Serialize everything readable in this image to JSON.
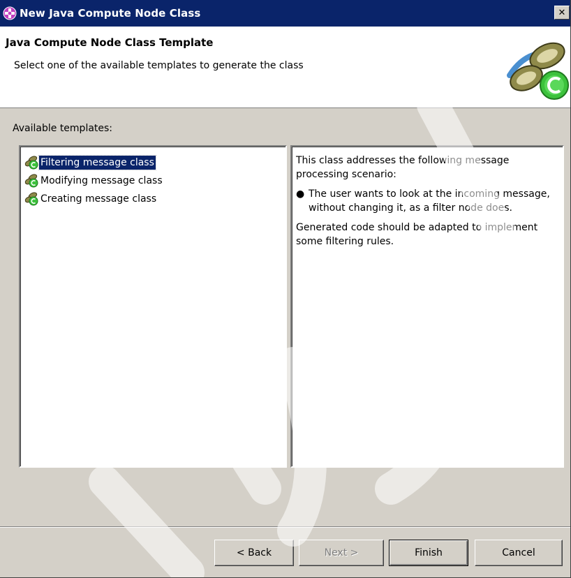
{
  "window": {
    "title": "New Java Compute Node Class",
    "close_glyph": "✕"
  },
  "banner": {
    "title": "Java Compute Node Class Template",
    "subtitle": "Select one of the available templates to generate the class"
  },
  "templates": {
    "label": "Available templates:",
    "items": [
      {
        "label": "Filtering message class",
        "icon": "java-compute-class-icon",
        "selected": true
      },
      {
        "label": "Modifying message class",
        "icon": "java-compute-class-icon",
        "selected": false
      },
      {
        "label": "Creating message class",
        "icon": "java-compute-class-icon",
        "selected": false
      }
    ]
  },
  "description": {
    "intro": "This class addresses the following message processing scenario:",
    "bullet": "The user wants to look at the incoming message, without changing it, as a filter node does.",
    "outro": "Generated code should be adapted to implement some filtering rules."
  },
  "buttons": {
    "back": "< Back",
    "next": "Next >",
    "finish": "Finish",
    "cancel": "Cancel"
  },
  "colors": {
    "titlebar": "#0a246a",
    "dialog": "#d4d0c8",
    "selection": "#0a246a"
  }
}
